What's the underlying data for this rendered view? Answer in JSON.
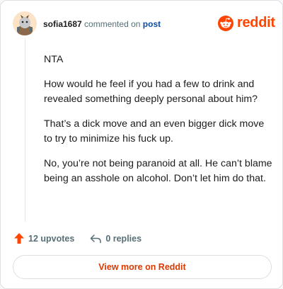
{
  "header": {
    "username": "sofia1687",
    "action_text": "commented on",
    "post_link": "post",
    "brand": "reddit"
  },
  "comment": {
    "paragraphs": [
      "NTA",
      "How would he feel if you had a few to drink and revealed something deeply personal about him?",
      "That’s a dick move and an even bigger dick move to try to minimize his fuck up.",
      "No, you’re not being paranoid at all. He can’t blame being an asshole on alcohol. Don’t let him do that."
    ]
  },
  "actions": {
    "upvotes": "12 upvotes",
    "replies": "0 replies"
  },
  "footer": {
    "view_more": "View more on Reddit"
  },
  "colors": {
    "brand": "#ff4500",
    "link": "#0b4ea2",
    "button_text": "#d93a00"
  },
  "icons": {
    "avatar": "avatar-snoo",
    "logo": "reddit-snoo-icon",
    "upvote": "upvote-arrow-icon",
    "reply": "reply-arrow-icon"
  }
}
